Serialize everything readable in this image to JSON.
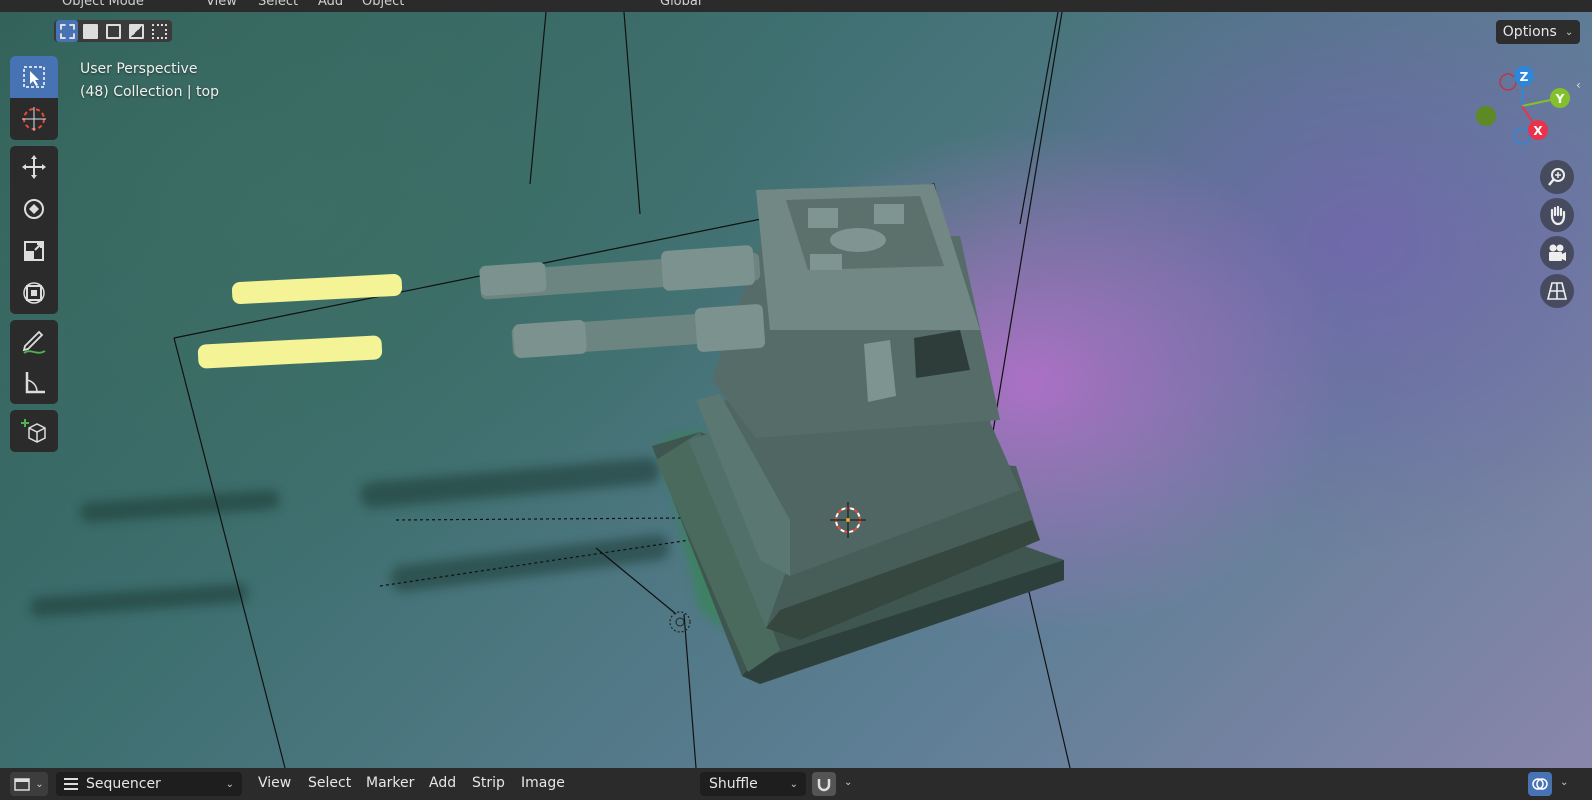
{
  "top_header": {
    "mode": "Object Mode",
    "menus": [
      "View",
      "Select",
      "Add",
      "Object"
    ],
    "transform_orientation": "Global"
  },
  "tool_header": {
    "options_label": "Options"
  },
  "viewport": {
    "view_name": "User Perspective",
    "collection_info": "(48) Collection | top",
    "gizmo_axes": {
      "z": "Z",
      "y": "Y",
      "x": "X"
    },
    "colors": {
      "x": "#e8344b",
      "y": "#84c02b",
      "z": "#2e86d8",
      "active_tool": "#4772b3"
    }
  },
  "toolbar": {
    "tools": [
      "select-box",
      "cursor",
      "move",
      "rotate",
      "scale",
      "transform",
      "annotate",
      "measure",
      "add-cube"
    ]
  },
  "bottom_header": {
    "editor_type": "Sequencer",
    "menus": [
      "View",
      "Select",
      "Marker",
      "Add",
      "Strip",
      "Image"
    ],
    "overlap_mode": "Shuffle"
  }
}
